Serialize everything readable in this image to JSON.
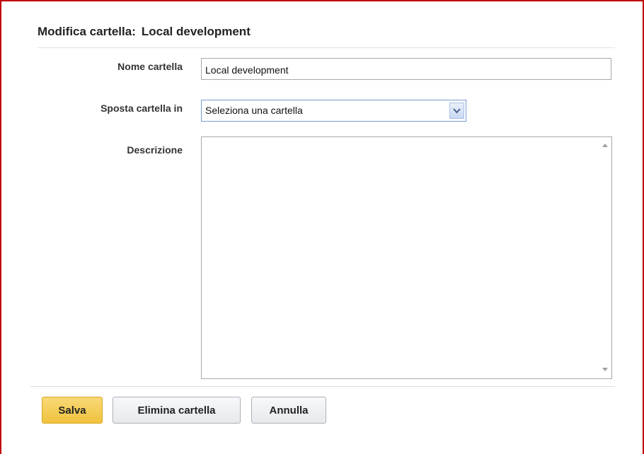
{
  "form": {
    "title_prefix": "Modifica cartella:",
    "title_name": "Local development",
    "folder_name": {
      "label": "Nome cartella",
      "value": "Local development"
    },
    "move_to": {
      "label": "Sposta cartella in",
      "selected": "Seleziona una cartella"
    },
    "description": {
      "label": "Descrizione",
      "value": ""
    }
  },
  "buttons": {
    "save": "Salva",
    "delete": "Elimina cartella",
    "cancel": "Annulla"
  },
  "colors": {
    "frame_border": "#c00000",
    "primary_button": "#f0c33d",
    "select_border": "#7a9cd3"
  },
  "icons": {
    "select_arrow": "chevron-down-icon",
    "scroll_up": "scroll-up-arrow-icon",
    "scroll_down": "scroll-down-arrow-icon"
  }
}
